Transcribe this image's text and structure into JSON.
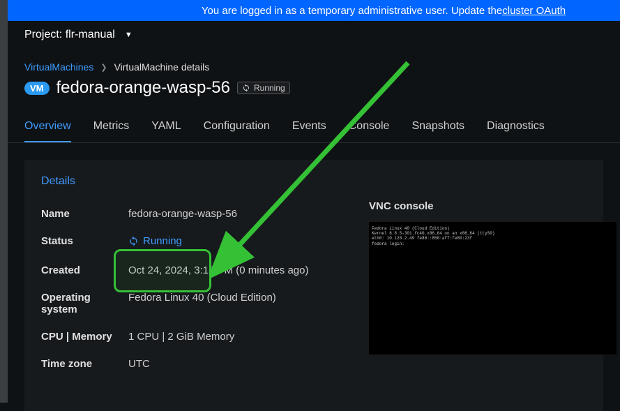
{
  "banner": {
    "prefix": "You are logged in as a temporary administrative user. Update the ",
    "link_text": "cluster OAuth "
  },
  "project": {
    "label": "Project:",
    "value": "flr-manual"
  },
  "breadcrumbs": {
    "parent": "VirtualMachines",
    "current": "VirtualMachine details"
  },
  "vm": {
    "badge": "VM",
    "name": "fedora-orange-wasp-56",
    "status_short": "Running"
  },
  "tabs": [
    {
      "label": "Overview",
      "active": true
    },
    {
      "label": "Metrics"
    },
    {
      "label": "YAML"
    },
    {
      "label": "Configuration"
    },
    {
      "label": "Events"
    },
    {
      "label": "Console"
    },
    {
      "label": "Snapshots"
    },
    {
      "label": "Diagnostics"
    }
  ],
  "details": {
    "section_title": "Details",
    "rows": [
      {
        "label": "Name",
        "value": "fedora-orange-wasp-56"
      },
      {
        "label": "Status",
        "value": "Running",
        "is_status": true
      },
      {
        "label": "Created",
        "value": "Oct 24, 2024, 3:15 PM (0 minutes ago)"
      },
      {
        "label": "Operating system",
        "value": "Fedora Linux 40 (Cloud Edition)"
      },
      {
        "label": "CPU | Memory",
        "value": "1 CPU | 2 GiB Memory"
      },
      {
        "label": "Time zone",
        "value": "UTC"
      }
    ],
    "vnc_title": "VNC console",
    "vnc_lines": [
      "Fedora Linux 40 (Cloud Edition)",
      "Kernel 6.8.5-301.fc40.x86_64 on an x86_64 (ttyS0)",
      "",
      "eth0: 10.128.2.49 fe80::858:aff:fe80:23f",
      "fedora login:"
    ]
  }
}
